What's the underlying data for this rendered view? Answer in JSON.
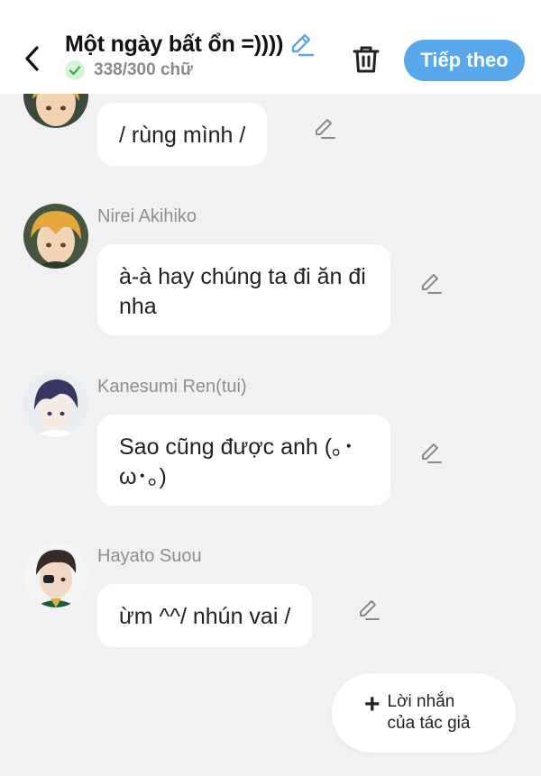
{
  "header": {
    "title": "Một ngày bất ổn =))))",
    "word_count": "338/300 chữ",
    "next_label": "Tiếp theo"
  },
  "messages": [
    {
      "sender": "",
      "text": "/ rùng mình /"
    },
    {
      "sender": "Nirei Akihiko",
      "text": "à-à hay chúng ta đi ăn đi nha"
    },
    {
      "sender": "Kanesumi Ren(tui)",
      "text": "Sao cũng được anh (｡･ω･｡)"
    },
    {
      "sender": "Hayato Suou",
      "text": "ừm ^^/ nhún vai /"
    }
  ],
  "author_note": {
    "label": "Lời nhắn\ncủa tác giả"
  },
  "colors": {
    "accent": "#5aa8ec",
    "background": "#f1f1f3",
    "bubble": "#ffffff",
    "check": "#3cb54a"
  },
  "icons": [
    "back-arrow-icon",
    "pencil-icon",
    "check-icon",
    "trash-icon",
    "plus-icon"
  ]
}
